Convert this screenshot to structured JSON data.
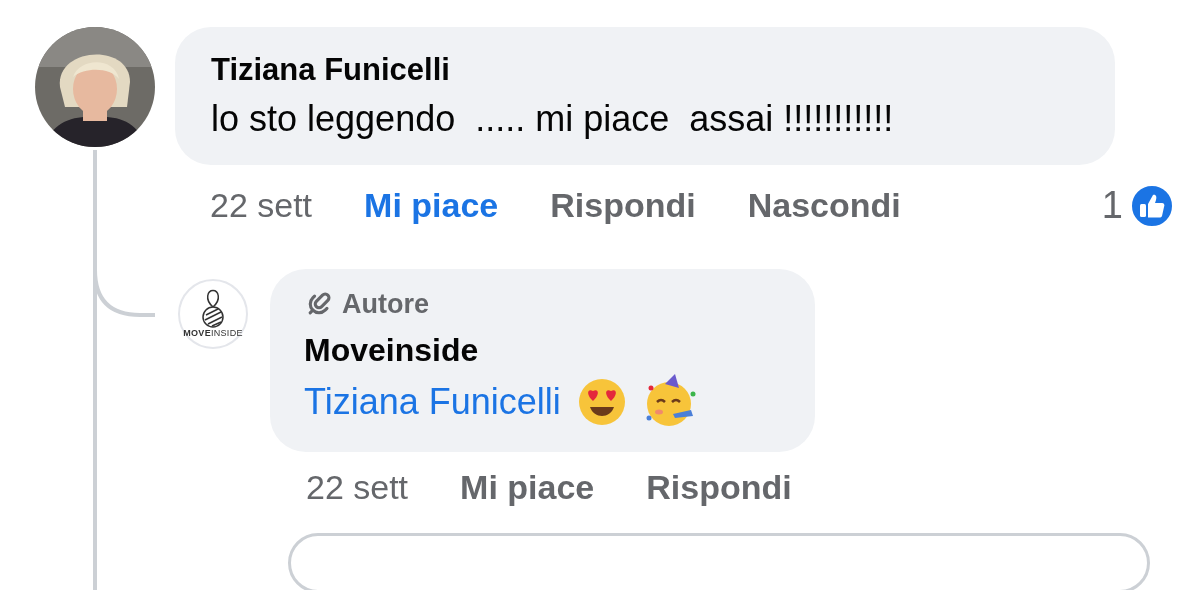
{
  "comment": {
    "author": "Tiziana Funicelli",
    "text": "lo sto leggendo  ..... mi piace  assai !!!!!!!!!!!",
    "actions": {
      "time": "22 sett",
      "like": "Mi piace",
      "reply": "Rispondi",
      "hide": "Nascondi",
      "liked": true
    },
    "reaction_count": "1"
  },
  "reply": {
    "badge": "Autore",
    "author": "Moveinside",
    "avatar_logo": "**MOVE**INSIDE",
    "mention": "Tiziana Funicelli",
    "actions": {
      "time": "22 sett",
      "like": "Mi piace",
      "reply": "Rispondi",
      "liked": false
    }
  }
}
